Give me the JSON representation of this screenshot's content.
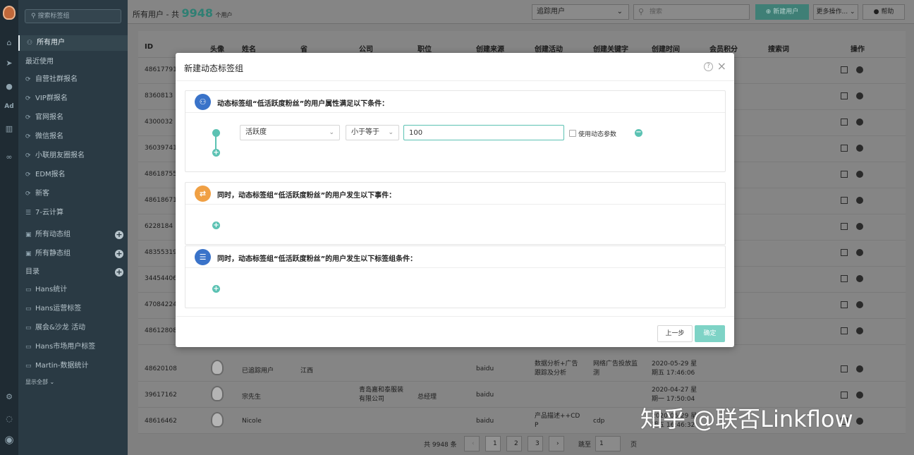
{
  "sidebar": {
    "search_placeholder": "搜索标签组",
    "all_users": "所有用户",
    "recent": "最近使用",
    "recent_items": [
      "自营社群报名",
      "VIP群报名",
      "官网报名",
      "微信报名",
      "小联朋友圈报名",
      "EDM报名",
      "新客",
      "7-云计算"
    ],
    "dynamic_groups": "所有动态组",
    "static_groups": "所有静态组",
    "directory": "目录",
    "folders": [
      "Hans统计",
      "Hans运营标签",
      "展会&沙龙 活动",
      "Hans市场用户标签",
      "Martin-数据统计"
    ],
    "show_all": "显示全部 ⌄"
  },
  "topbar": {
    "title_prefix": "所有用户 - 共",
    "count": "9948",
    "title_suffix": "个用户",
    "track_select": "追踪用户",
    "search_placeholder": "搜索",
    "new_user": "新建用户",
    "more_actions": "更多操作... ⌄",
    "help": "帮助"
  },
  "table": {
    "headers": [
      "ID",
      "头像",
      "姓名",
      "省",
      "公司",
      "职位",
      "创建来源",
      "创建活动",
      "创建关键字",
      "创建时间",
      "会员积分",
      "搜索词",
      "操作"
    ],
    "bg_ids": [
      "48617791",
      "8360813",
      "4300032",
      "36039741",
      "48618755",
      "48618671",
      "6228184",
      "48355319",
      "34454406",
      "47084224",
      "48612808"
    ],
    "rows": [
      {
        "id": "48620108",
        "name": "已追踪用户",
        "province": "江西",
        "company": "",
        "position": "",
        "source": "baidu",
        "activity": "数据分析+广告 跟踪及分析",
        "keyword": "网络广告投放监 测",
        "time": "2020-05-29 星 期五 17:46:06"
      },
      {
        "id": "39617162",
        "name": "宗先生",
        "province": "",
        "company": "青岛嘉和泰服装 有限公司",
        "position": "总经理",
        "source": "baidu",
        "activity": "",
        "keyword": "",
        "time": "2020-04-27 星 期一 17:50:04"
      },
      {
        "id": "48616462",
        "name": "Nicole",
        "province": "",
        "company": "",
        "position": "",
        "source": "baidu",
        "activity": "产品描述++CD P",
        "keyword": "cdp",
        "time": "2020-05-29 星 期五 16:46:32"
      }
    ],
    "pager": {
      "total": "共 9948 条",
      "prev": "‹",
      "pages": [
        "1",
        "2",
        "3"
      ],
      "next": "›",
      "goto": "跳至",
      "goto_value": "1",
      "page_unit": "页"
    }
  },
  "dialog": {
    "title": "新建动态标签组",
    "section1_title": "动态标签组“低活跃度粉丝”的用户属性满足以下条件：",
    "attr_field": "活跃度",
    "operator": "小于等于",
    "value": "100",
    "dynamic_param": "使用动态参数",
    "section2_title": "同时，动态标签组“低活跃度粉丝”的用户发生以下事件：",
    "section3_title": "同时，动态标签组“低活跃度粉丝”的用户发生以下标签组条件：",
    "prev_button": "上一步",
    "ok_button": "确定"
  },
  "watermark": "知乎 @联否Linkflow",
  "colors": {
    "accent": "#5cc2b3",
    "sidebar": "#2a3a44",
    "rail": "#1f2b33",
    "section1_icon": "#3a73c9",
    "section2_icon": "#f0a044",
    "section3_icon": "#3a73c9"
  }
}
